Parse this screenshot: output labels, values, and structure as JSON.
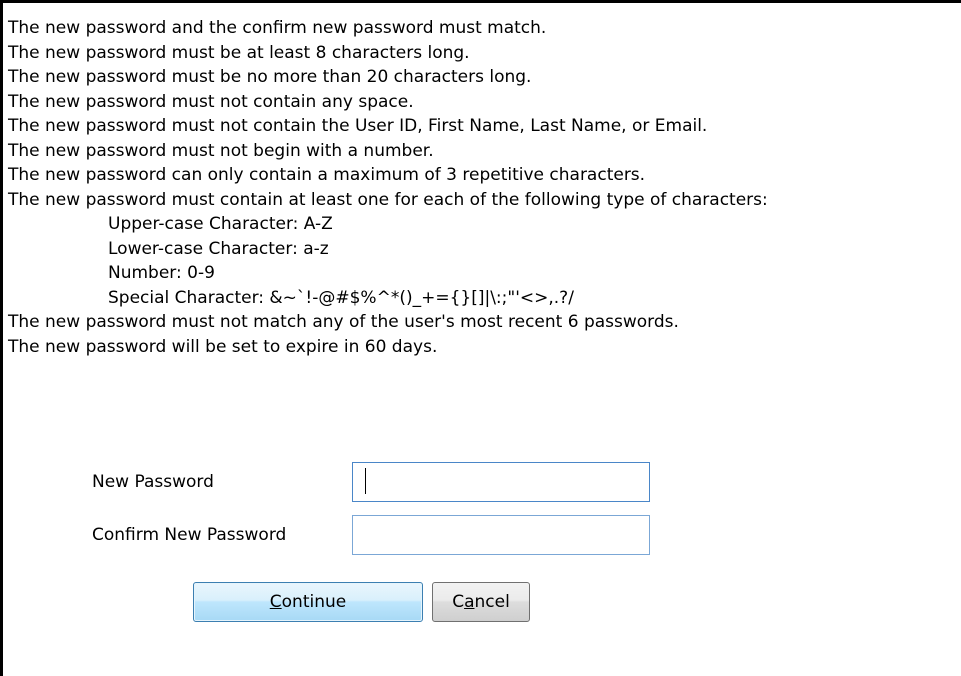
{
  "rules": [
    {
      "text": "The new password and the confirm new password must match.",
      "indent": false
    },
    {
      "text": "The new password must be at least 8 characters long.",
      "indent": false
    },
    {
      "text": "The new password must be no more than 20 characters long.",
      "indent": false
    },
    {
      "text": "The new password must not contain any space.",
      "indent": false
    },
    {
      "text": "The new password must not contain the User ID, First Name, Last Name, or Email.",
      "indent": false
    },
    {
      "text": "The new password must not begin with a number.",
      "indent": false
    },
    {
      "text": "The new password can only contain a maximum of 3 repetitive characters.",
      "indent": false
    },
    {
      "text": "The new password must contain at least one for each of the following type of characters:",
      "indent": false
    },
    {
      "text": "Upper-case Character: A-Z",
      "indent": true
    },
    {
      "text": "Lower-case Character: a-z",
      "indent": true
    },
    {
      "text": "Number: 0-9",
      "indent": true
    },
    {
      "text": "Special Character: &~`!-@#$%^*()_+={}[]|\\:;\"'<>,.?/",
      "indent": true
    },
    {
      "text": "The new password must not match any of the user's most recent 6 passwords.",
      "indent": false
    },
    {
      "text": "The new password will be set to expire in 60 days.",
      "indent": false
    }
  ],
  "form": {
    "new_password_label": "New Password",
    "new_password_value": "",
    "confirm_password_label": "Confirm New Password",
    "confirm_password_value": ""
  },
  "buttons": {
    "continue_accel": "C",
    "continue_rest": "ontinue",
    "cancel_pre": "C",
    "cancel_accel": "a",
    "cancel_rest": "ncel"
  }
}
